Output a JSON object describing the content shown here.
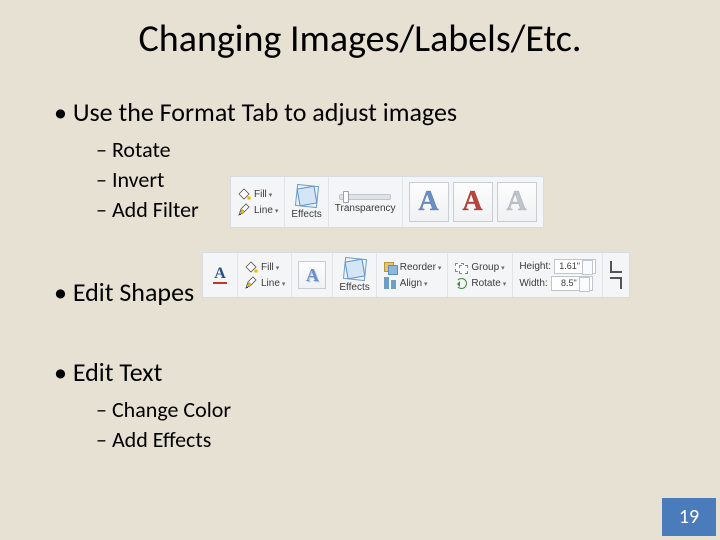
{
  "title": "Changing Images/Labels/Etc.",
  "bullets": {
    "use_format": "Use the Format Tab to adjust images",
    "rotate": "Rotate",
    "invert": "Invert",
    "add_filter": "Add Filter",
    "edit_shapes": "Edit Shapes",
    "edit_text": "Edit Text",
    "change_color": "Change Color",
    "add_effects": "Add Effects"
  },
  "page_number": "19",
  "ribbon_top": {
    "fill": "Fill",
    "line": "Line",
    "effects": "Effects",
    "transparency": "Transparency"
  },
  "ribbon_bottom": {
    "fill": "Fill",
    "line": "Line",
    "effects": "Effects",
    "reorder": "Reorder",
    "align": "Align",
    "group": "Group",
    "rotate": "Rotate",
    "height_label": "Height:",
    "width_label": "Width:",
    "height_value": "1.61\"",
    "width_value": "8.5\""
  }
}
